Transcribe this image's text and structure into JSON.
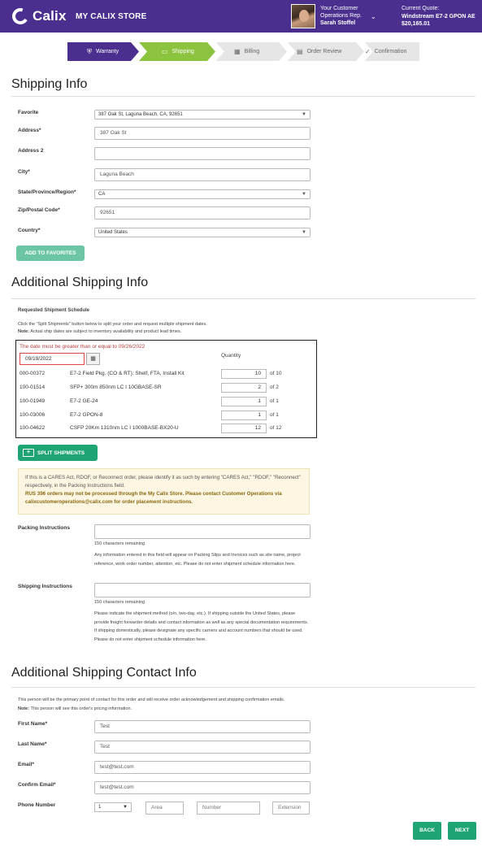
{
  "header": {
    "brand": "Calix",
    "store": "MY CALIX STORE",
    "rep_line1": "Your Customer",
    "rep_line2": "Operations Rep.",
    "rep_name": "Sarah Stoffel",
    "quote_label": "Current Quote:",
    "quote_name": "Windstream E7-2 GPON AE",
    "quote_amount": "$20,165.01"
  },
  "steps": [
    {
      "label": "Warranty",
      "icon": "shield-icon",
      "state": "done",
      "color": "#4a2f8f"
    },
    {
      "label": "Shipping",
      "icon": "truck-icon",
      "state": "active",
      "color": "#8cc43f"
    },
    {
      "label": "Billing",
      "icon": "billing-icon",
      "state": "pending",
      "color": "#e6e6e6"
    },
    {
      "label": "Order Review",
      "icon": "document-icon",
      "state": "pending",
      "color": "#e6e6e6"
    },
    {
      "label": "Confirmation",
      "icon": "checkmark-icon",
      "state": "pending",
      "color": "#e6e6e6"
    }
  ],
  "shipping_info": {
    "heading": "Shipping Info",
    "favorite_label": "Favorite",
    "favorite_value": "387 Oak St, Laguna Beach, CA, 92651",
    "address_label": "Address*",
    "address_value": "387 Oak St",
    "address2_label": "Address 2",
    "address2_value": "",
    "city_label": "City*",
    "city_value": "Laguna Beach",
    "state_label": "State/Province/Region*",
    "state_value": "CA",
    "zip_label": "Zip/Postal Code*",
    "zip_value": "92651",
    "country_label": "Country*",
    "country_value": "United States",
    "add_favorites": "ADD TO FAVORITES"
  },
  "additional": {
    "heading": "Additional Shipping Info",
    "schedule_title": "Requested Shipment Schedule",
    "schedule_hint": "Click the \"Split Shipments\" button below to split your order and request multiple shipment dates.",
    "note_label": "Note:",
    "note_text": " Actual ship dates are subject to inventory availability and product lead times.",
    "date_warning": "The date must be greater than or equal to 09/26/2022",
    "date_value": "09/19/2022",
    "quantity_header": "Quantity",
    "rows": [
      {
        "sku": "000-00372",
        "desc": "E7-2 Field Pkg. (CO & RT): Shelf, FTA, Install Kit",
        "qty": "10",
        "of": "of 10"
      },
      {
        "sku": "100-01514",
        "desc": "SFP+ 300m 850nm LC I 10GBASE-SR",
        "qty": "2",
        "of": "of 2"
      },
      {
        "sku": "100-01949",
        "desc": "E7-2 GE-24",
        "qty": "1",
        "of": "of 1"
      },
      {
        "sku": "100-03006",
        "desc": "E7-2 GPON-8",
        "qty": "1",
        "of": "of 1"
      },
      {
        "sku": "100-04622",
        "desc": "CSFP 20Km 1310nm LC I 1000BASE-BX20-U",
        "qty": "12",
        "of": "of 12"
      }
    ],
    "split_button": "SPLIT SHIPMENTS",
    "notice_text": "If this is a CARES Act, RDOF, or Reconnect order, please identify it as such by entering \"CARES Act,\" \"RDOF,\" \"Reconnect\" respectively, in the Packing Instructions field.",
    "notice_bold": "RUS 396 orders may not be processed through the My Calix Store. Please contact Customer Operations via calixcustomeroperations@calix.com for order placement instructions.",
    "packing_label": "Packing Instructions",
    "packing_remaining": "150 characters remaining",
    "packing_help": "Any information entered in this field will appear on Packing Slips and Invoices such as site name, project reference, work order number, attention, etc. Please do not enter shipment schedule information here.",
    "shipping_label": "Shipping Instructions",
    "shipping_remaining": "150 characters remaining",
    "shipping_help": "Please indicate the shipment method (o/n, two-day, etc.). If shipping outside the United States, please provide freight forwarder details and contact information as well as any special documentation requirements. If shipping domestically, please designate any specific carriers and account numbers that should be used. Please do not enter shipment schedule information here."
  },
  "contact": {
    "heading": "Additional Shipping Contact Info",
    "intro": "This person will be the primary point of contact for this order and will receive order acknowledgement and shipping confirmation emails.",
    "note_label": "Note:",
    "note_text": " This person will see this order's pricing information.",
    "first_label": "First Name*",
    "first_value": "Test",
    "last_label": "Last Name*",
    "last_value": "Test",
    "email_label": "Email*",
    "email_value": "test@test.com",
    "confirm_label": "Confirm Email*",
    "confirm_value": "test@test.com",
    "phone_label": "Phone Number",
    "phone_country": "1",
    "area_placeholder": "Area",
    "number_placeholder": "Number",
    "ext_placeholder": "Extension"
  },
  "nav": {
    "back": "BACK",
    "next": "NEXT"
  }
}
